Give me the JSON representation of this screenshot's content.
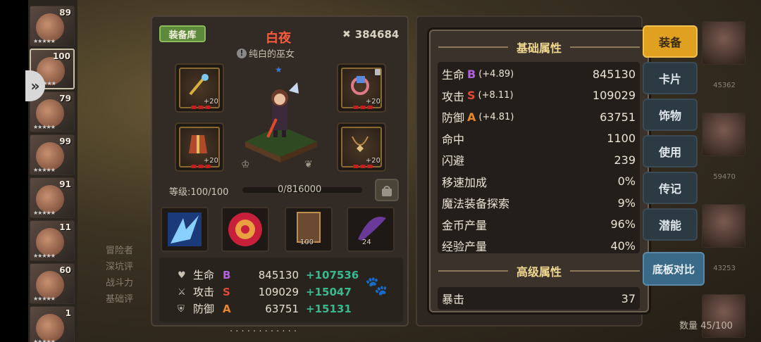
{
  "roster": {
    "levels": [
      "89",
      "100",
      "79",
      "99",
      "91",
      "11",
      "60",
      "1"
    ]
  },
  "equipment": {
    "library_label": "装备库",
    "char_name": "白夜",
    "char_title": "纯白的巫女",
    "power": "384684",
    "slots_plus": [
      "+20",
      "+20",
      "+20",
      "+20"
    ],
    "level_label": "等级:100/100",
    "xp_label": "0/816000",
    "skill_subs": [
      "100",
      "24"
    ],
    "stats": [
      {
        "label": "生命",
        "grade": "B",
        "grade_color": "#b060e0",
        "value": "845130",
        "bonus": "+107536"
      },
      {
        "label": "攻击",
        "grade": "S",
        "grade_color": "#e04a3a",
        "value": "109029",
        "bonus": "+15047"
      },
      {
        "label": "防御",
        "grade": "A",
        "grade_color": "#e8882a",
        "value": "63751",
        "bonus": "+15131"
      }
    ]
  },
  "popup": {
    "basic_title": "基础属性",
    "advanced_title": "高级属性",
    "basic_attrs": [
      {
        "name": "生命",
        "grade": "B",
        "grade_color": "#b060e0",
        "inc": "(+4.89)",
        "value": "845130"
      },
      {
        "name": "攻击",
        "grade": "S",
        "grade_color": "#e04a3a",
        "inc": "(+8.11)",
        "value": "109029"
      },
      {
        "name": "防御",
        "grade": "A",
        "grade_color": "#e8882a",
        "inc": "(+4.81)",
        "value": "63751"
      },
      {
        "name": "命中",
        "grade": "",
        "grade_color": "",
        "inc": "",
        "value": "1100"
      },
      {
        "name": "闪避",
        "grade": "",
        "grade_color": "",
        "inc": "",
        "value": "239"
      },
      {
        "name": "移速加成",
        "grade": "",
        "grade_color": "",
        "inc": "",
        "value": "0%"
      },
      {
        "name": "魔法装备探索",
        "grade": "",
        "grade_color": "",
        "inc": "",
        "value": "9%"
      },
      {
        "name": "金币产量",
        "grade": "",
        "grade_color": "",
        "inc": "",
        "value": "96%"
      },
      {
        "name": "经验产量",
        "grade": "",
        "grade_color": "",
        "inc": "",
        "value": "40%"
      }
    ],
    "advanced_attrs": [
      {
        "name": "暴击",
        "value": "37"
      }
    ]
  },
  "right_menu": {
    "items": [
      "装备",
      "卡片",
      "饰物",
      "使用",
      "传记",
      "潜能"
    ],
    "compare": "底板对比",
    "right_numbers": [
      "45362",
      "59470",
      "43253"
    ],
    "count": "数量 45/100"
  }
}
